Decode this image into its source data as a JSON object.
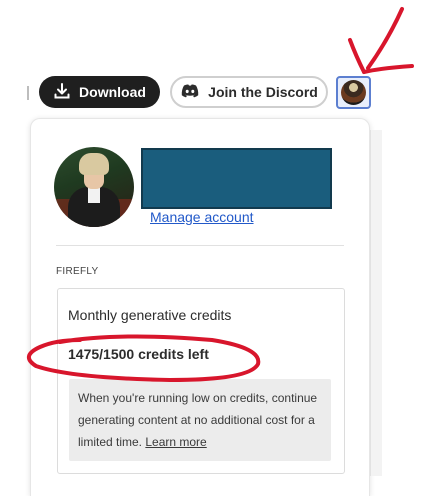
{
  "toolbar": {
    "download_label": "Download",
    "discord_label": "Join the Discord"
  },
  "profile": {
    "manage_account_label": "Manage account"
  },
  "section": {
    "label": "FIREFLY"
  },
  "credits": {
    "title": "Monthly generative credits",
    "used": 1475,
    "total": 1500,
    "status_text": "1475/1500 credits left",
    "info_text": "When you're running low on credits, continue generating content at no additional cost for a limited time. ",
    "learn_more_label": "Learn more"
  },
  "colors": {
    "accent_link": "#2259c9",
    "annotation_red": "#d8162c",
    "redaction_blue": "#1a5d7d"
  },
  "icons": [
    "download-icon",
    "discord-icon",
    "avatar-icon",
    "arrow-annotation-icon"
  ]
}
